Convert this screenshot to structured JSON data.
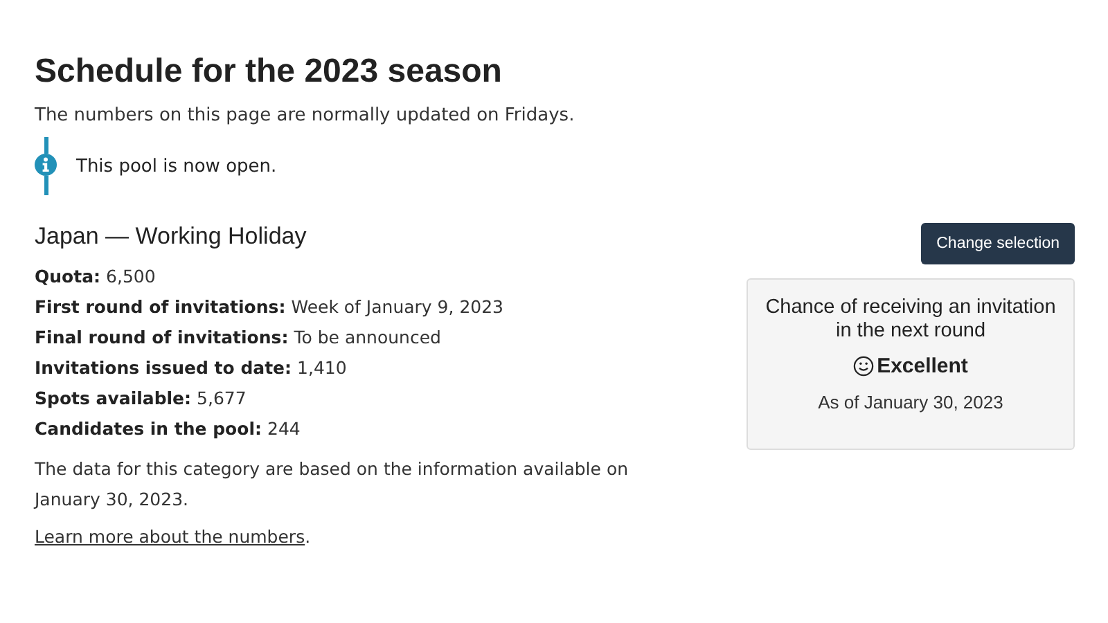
{
  "title": "Schedule for the 2023 season",
  "intro": "The numbers on this page are normally updated on Fridays.",
  "notice": {
    "text": "This pool is now open."
  },
  "category": {
    "heading": "Japan — Working Holiday",
    "facts": [
      {
        "label": "Quota:",
        "value": "6,500"
      },
      {
        "label": "First round of invitations:",
        "value": "Week of January 9, 2023"
      },
      {
        "label": "Final round of invitations:",
        "value": "To be announced"
      },
      {
        "label": "Invitations issued to date:",
        "value": "1,410"
      },
      {
        "label": "Spots available:",
        "value": "5,677"
      },
      {
        "label": "Candidates in the pool:",
        "value": "244"
      }
    ],
    "note": "The data for this category are based on the information available on January 30, 2023.",
    "link": {
      "text": "Learn more about the numbers",
      "after": "."
    }
  },
  "button": "Change selection",
  "chance": {
    "heading": "Chance of receiving an invitation in the next round",
    "rating": "Excellent",
    "as_of": "As of January 30, 2023"
  }
}
